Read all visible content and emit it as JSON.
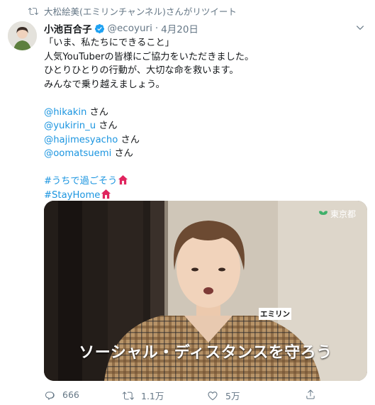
{
  "retweet": {
    "text": "大松絵美(エミリンチャンネル)さんがリツイート"
  },
  "tweet": {
    "display_name": "小池百合子",
    "handle": "@ecoyuri",
    "separator": "·",
    "date": "4月20日",
    "lines": [
      "「いま、私たちにできること」",
      "人気YouTuberの皆様にご協力をいただきました。",
      "ひとりひとりの行動が、大切な命を救います。",
      "みんなで乗り越えましょう。"
    ],
    "mentions": [
      {
        "handle": "@hikakin",
        "suffix": " さん"
      },
      {
        "handle": "@yukirin_u",
        "suffix": " さん"
      },
      {
        "handle": "@hajimesyacho",
        "suffix": " さん"
      },
      {
        "handle": "@oomatsuemi",
        "suffix": " さん"
      }
    ],
    "hashtags": [
      "#うちで過ごそう",
      "#StayHome"
    ]
  },
  "media": {
    "watermark": "東京都",
    "name_label": "エミリン",
    "caption": "ソーシャル・ディスタンスを守ろう"
  },
  "actions": {
    "replies": "666",
    "retweets": "1.1万",
    "likes": "5万"
  },
  "icons": {
    "retweet": "retweet-icon",
    "verified": "verified-badge-icon",
    "caret": "chevron-down-icon",
    "house": "house-emoji-icon",
    "reply": "reply-icon",
    "like": "heart-icon",
    "share": "share-icon"
  },
  "colors": {
    "link": "#1b95e0",
    "muted": "#657786",
    "verified": "#1da1f2",
    "house": "#e0245e"
  }
}
